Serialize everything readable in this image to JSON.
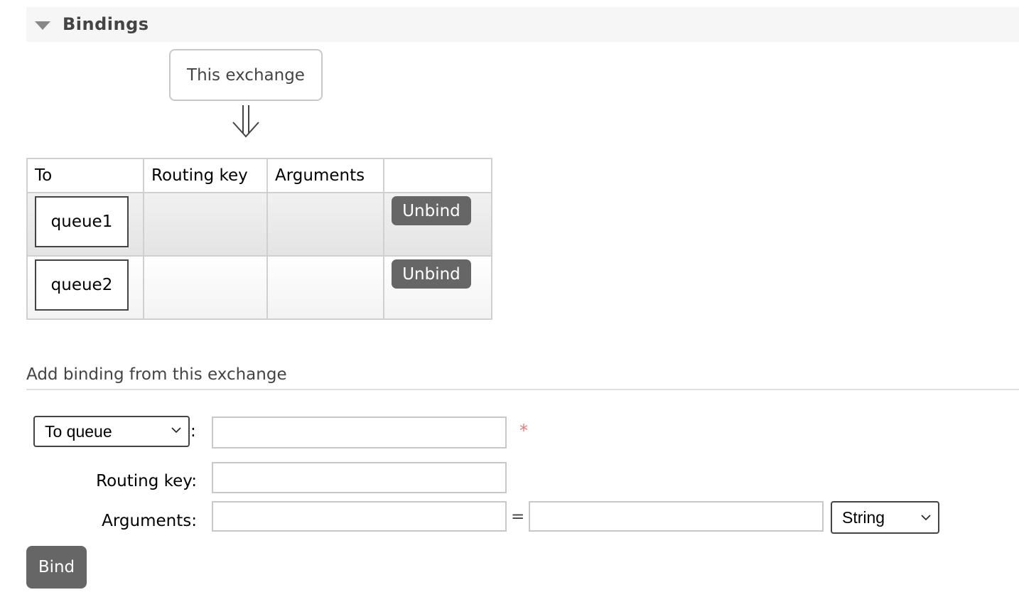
{
  "section": {
    "title": "Bindings"
  },
  "source": {
    "label": "This exchange"
  },
  "table": {
    "headers": [
      "To",
      "Routing key",
      "Arguments",
      ""
    ],
    "rows": [
      {
        "to": "queue1",
        "routing_key": "",
        "arguments": "",
        "action": "Unbind"
      },
      {
        "to": "queue2",
        "routing_key": "",
        "arguments": "",
        "action": "Unbind"
      }
    ]
  },
  "add_binding": {
    "title": "Add binding from this exchange",
    "destination_type": "To queue",
    "destination_value": "",
    "required_marker": "*",
    "routing_key_label": "Routing key:",
    "routing_key_value": "",
    "arguments_label": "Arguments:",
    "argument_key": "",
    "equals": "=",
    "argument_value": "",
    "argument_type": "String",
    "bind_label": "Bind"
  },
  "colors": {
    "button_bg": "#666666",
    "required": "#e27d7d"
  }
}
